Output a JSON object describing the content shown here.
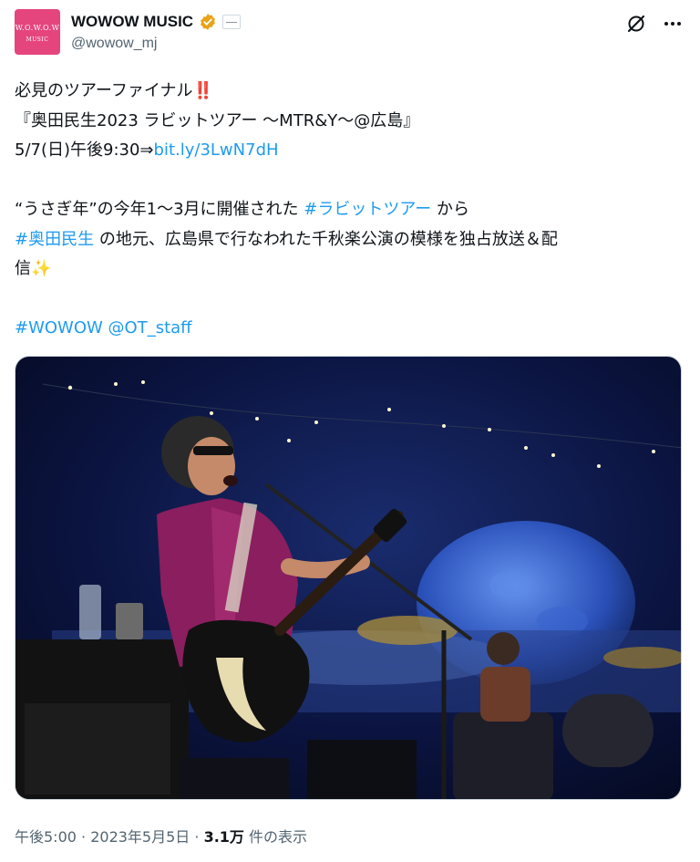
{
  "account": {
    "avatar_line1": "W.O.W.O.W",
    "avatar_line2": "MUSIC",
    "display_name": "WOWOW MUSIC",
    "handle": "@wowow_mj",
    "verified_color": "#e8a317",
    "avatar_color": "#e5457d"
  },
  "icons": {
    "grok": "grok-icon",
    "more": "more-horizontal-icon",
    "verified": "verified-badge-icon",
    "affiliate": "affiliate-badge-icon"
  },
  "tweet": {
    "line1_text": "必見のツアーファイナル",
    "line1_emoji": "‼️",
    "line2_text": "『奥田民生2023 ラビットツアー 〜MTR&Y〜@広島』",
    "line3_text": "5/7(日)午後9:30⇒",
    "line3_link": "bit.ly/3LwN7dH",
    "line5_text_a": "“うさぎ年”の今年1〜3月に開催された ",
    "line5_hashtag": "#ラビットツアー",
    "line5_text_b": " から",
    "line6_hashtag": "#奥田民生",
    "line6_text": " の地元、広島県で行なわれた千秋楽公演の模様を独占放送＆配",
    "line7_text": "信",
    "line7_emoji": "✨",
    "line9_hashtag": "#WOWOW",
    "line9_mention": "@OT_staff"
  },
  "meta": {
    "time": "午後5:00",
    "separator": " · ",
    "date": "2023年5月5日",
    "views_count": "3.1万",
    "views_label": " 件の表示"
  },
  "colors": {
    "link": "#1d9bf0",
    "text": "#0f1419",
    "secondary": "#536471"
  }
}
